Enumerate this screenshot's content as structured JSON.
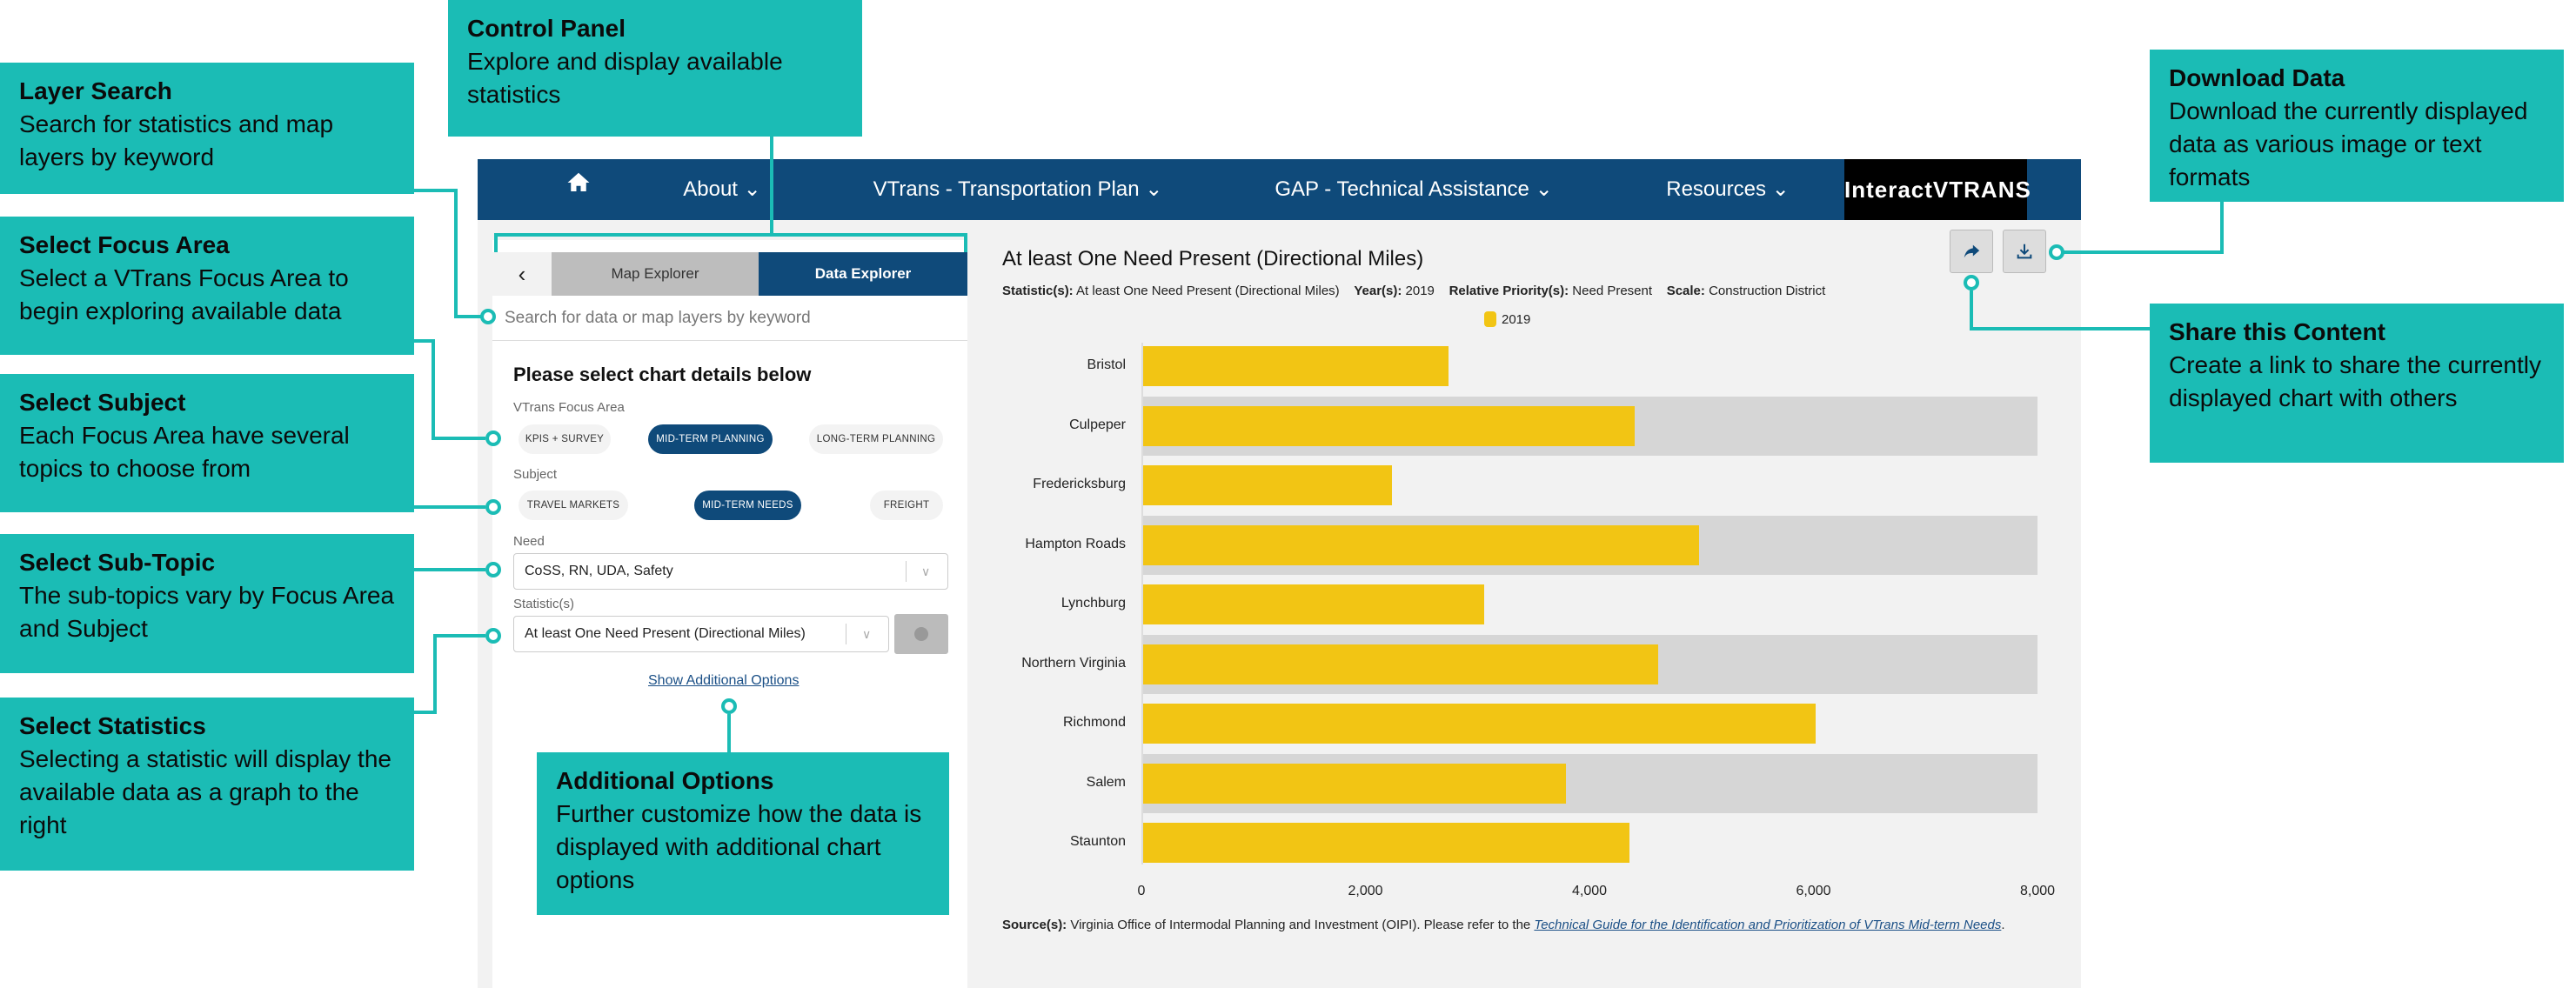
{
  "annotations": {
    "control_panel": {
      "title": "Control Panel",
      "body": "Explore and display available statistics"
    },
    "layer_search": {
      "title": "Layer Search",
      "body": "Search for statistics and map layers by keyword"
    },
    "focus_area": {
      "title": "Select Focus Area",
      "body": "Select a VTrans Focus Area to begin exploring available data"
    },
    "subject": {
      "title": "Select Subject",
      "body": "Each Focus Area have several topics to choose from"
    },
    "sub_topic": {
      "title": "Select Sub-Topic",
      "body": "The sub-topics vary by Focus Area and Subject"
    },
    "statistics": {
      "title": "Select Statistics",
      "body": "Selecting a statistic will display the available data as a graph to the right"
    },
    "additional": {
      "title": "Additional Options",
      "body": "Further customize how the data is displayed with additional chart options"
    },
    "download": {
      "title": "Download Data",
      "body": "Download the currently displayed data as various image or text formats"
    },
    "share": {
      "title": "Share this Content",
      "body": "Create a link to share the currently displayed chart with others"
    }
  },
  "nav": {
    "items": [
      "About",
      "VTrans - Transportation Plan",
      "GAP - Technical Assistance",
      "Resources"
    ],
    "logo": "InteractVTRANS",
    "home_icon": "home-icon"
  },
  "panel": {
    "tabs": [
      "Map Explorer",
      "Data Explorer"
    ],
    "search_placeholder": "Search for data or map layers by keyword",
    "heading": "Please select chart details below",
    "focus_label": "VTrans Focus Area",
    "focus_options": [
      "KPIS + SURVEY",
      "MID-TERM PLANNING",
      "LONG-TERM PLANNING"
    ],
    "focus_selected": "MID-TERM PLANNING",
    "subject_label": "Subject",
    "subject_options": [
      "TRAVEL MARKETS",
      "MID-TERM NEEDS",
      "FREIGHT"
    ],
    "subject_selected": "MID-TERM NEEDS",
    "need_label": "Need",
    "need_value": "CoSS, RN, UDA, Safety",
    "statistic_label": "Statistic(s)",
    "statistic_value": "At least One Need Present (Directional Miles)",
    "more_link": "Show Additional Options"
  },
  "chart_header": {
    "title": "At least One Need Present (Directional Miles)",
    "meta": [
      {
        "k": "Statistic(s):",
        "v": "At least One Need Present (Directional Miles)"
      },
      {
        "k": "Year(s):",
        "v": "2019"
      },
      {
        "k": "Relative Priority(s):",
        "v": "Need Present"
      },
      {
        "k": "Scale:",
        "v": "Construction District"
      }
    ],
    "source_label": "Source(s):",
    "source_text": "Virginia Office of Intermodal Planning and Investment (OIPI).  Please refer to the ",
    "source_link": "Technical Guide for the Identification and Prioritization of VTrans Mid-term Needs",
    "source_end": "."
  },
  "chart_data": {
    "type": "bar",
    "orientation": "horizontal",
    "categories": [
      "Bristol",
      "Culpeper",
      "Fredericksburg",
      "Hampton Roads",
      "Lynchburg",
      "Northern Virginia",
      "Richmond",
      "Salem",
      "Staunton"
    ],
    "series": [
      {
        "name": "2019",
        "values": [
          2740,
          4400,
          2240,
          4980,
          3060,
          4610,
          6020,
          3790,
          4360
        ],
        "color": "#f2c514"
      }
    ],
    "xlim": [
      0,
      8000
    ],
    "xticks": [
      0,
      2000,
      4000,
      6000,
      8000
    ],
    "xtick_labels": [
      "0",
      "2,000",
      "4,000",
      "6,000",
      "8,000"
    ],
    "legend": "top",
    "grid": false,
    "band_color": "#d6d6d6"
  },
  "colors": {
    "accent": "#1bbcb5",
    "nav": "#0f4a7a",
    "bar": "#f2c514"
  }
}
